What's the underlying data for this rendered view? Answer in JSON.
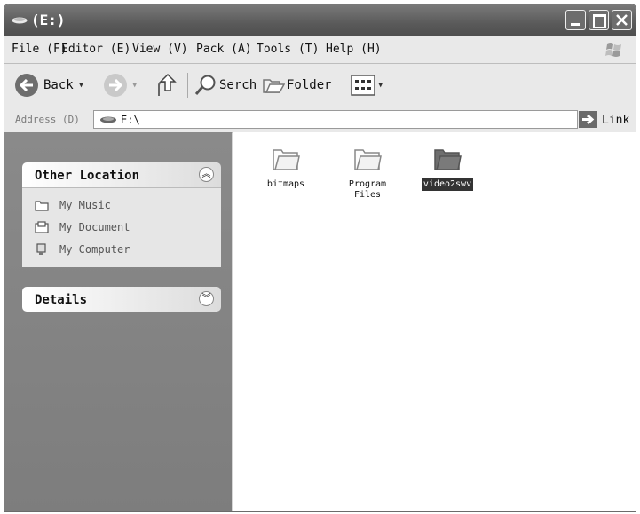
{
  "window": {
    "title": "(E:)"
  },
  "menu": [
    "File (F)",
    "Editor (E)",
    "View (V)",
    "Pack (A)",
    "Tools (T)",
    "Help (H)"
  ],
  "toolbar": {
    "back_label": "Back",
    "search_label": "Serch",
    "folder_label": "Folder"
  },
  "address": {
    "label": "Address (D)",
    "value": "E:\\",
    "go_label": "Link"
  },
  "sidebar": {
    "other_location": {
      "title": "Other Location",
      "items": [
        {
          "label": "My Music",
          "icon": "folder-icon"
        },
        {
          "label": "My Document",
          "icon": "document-icon"
        },
        {
          "label": "My Computer",
          "icon": "computer-icon"
        }
      ]
    },
    "details": {
      "title": "Details"
    }
  },
  "files": [
    {
      "name": "bitmaps",
      "selected": false
    },
    {
      "name": "Program Files",
      "selected": false
    },
    {
      "name": "video2swv",
      "selected": true
    }
  ],
  "colors": {
    "titlebar": "#5a5a5a",
    "sidebar": "#858585",
    "selection": "#333333"
  }
}
